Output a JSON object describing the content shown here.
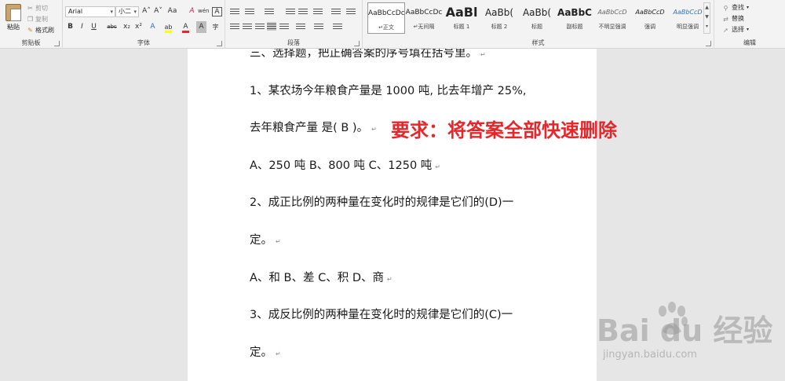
{
  "ribbon": {
    "clipboard": {
      "paste_label": "粘贴",
      "cut_label": "剪切",
      "copy_label": "复制",
      "format_painter_label": "格式刷",
      "group_label": "剪贴板"
    },
    "font": {
      "font_name": "Arial",
      "font_size": "小二",
      "grow_font": "A˄",
      "shrink_font": "A˅",
      "change_case": "Aa",
      "clear_format": "A",
      "phonetic": "wén",
      "char_border": "A",
      "bold": "B",
      "italic": "I",
      "underline": "U",
      "strikethrough": "abc",
      "subscript": "x₂",
      "superscript": "x²",
      "text_effects": "A",
      "highlight": "ab",
      "font_color": "A",
      "char_shading": "A",
      "enclose": "字",
      "group_label": "字体"
    },
    "paragraph": {
      "group_label": "段落"
    },
    "styles": {
      "group_label": "样式",
      "items": [
        {
          "sample": "AaBbCcDc",
          "name": "↵正文"
        },
        {
          "sample": "AaBbCcDc",
          "name": "↵无间隔"
        },
        {
          "sample": "AaBl",
          "name": "标题 1"
        },
        {
          "sample": "AaBb(",
          "name": "标题 2"
        },
        {
          "sample": "AaBb(",
          "name": "标题"
        },
        {
          "sample": "AaBbC",
          "name": "副标题"
        },
        {
          "sample": "AaBbCcD",
          "name": "不明显强调"
        },
        {
          "sample": "AaBbCcD",
          "name": "强调"
        },
        {
          "sample": "AaBbCcD",
          "name": "明显强调"
        }
      ]
    },
    "editing": {
      "find_label": "查找",
      "replace_label": "替换",
      "select_label": "选择",
      "group_label": "编辑"
    }
  },
  "document": {
    "lines": [
      "三、选择题，把正确答案的序号填在括号里。",
      "1、某农场今年粮食产量是 1000 吨, 比去年增产 25%,",
      "去年粮食产量  是( B )。",
      "A、250 吨  B、800 吨  C、1250 吨",
      "2、成正比例的两种量在变化时的规律是它们的(D)一",
      "定。",
      "A、和  B、差  C、积  D、商",
      "3、成反比例的两种量在变化时的规律是它们的(C)一",
      "定。"
    ],
    "paragraph_mark": "↵"
  },
  "annotation": {
    "text": "要求：将答案全部快速删除",
    "color": "#e8262a"
  },
  "watermark": {
    "logo": "Bai du 经验",
    "url": "jingyan.baidu.com"
  },
  "colors": {
    "highlight_yellow": "#ffff00",
    "font_red": "#e8262a",
    "ribbon_bg": "#f3f3f3",
    "workspace_bg": "#e6e6e6"
  }
}
